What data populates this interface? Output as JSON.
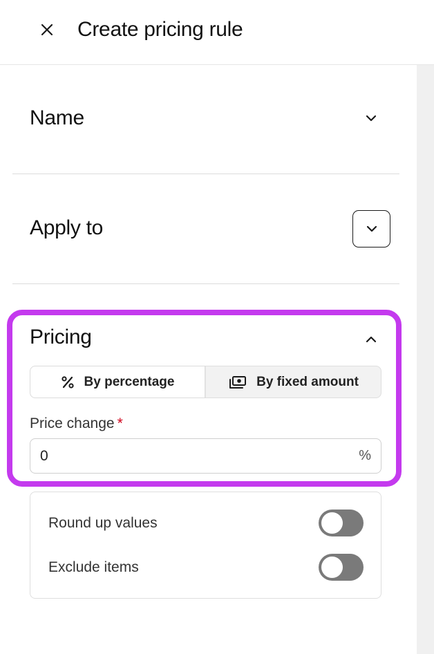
{
  "header": {
    "title": "Create pricing rule",
    "close_icon": "close-icon"
  },
  "sections": {
    "name": {
      "title": "Name",
      "expanded": false
    },
    "apply_to": {
      "title": "Apply to",
      "expanded": false
    },
    "pricing": {
      "title": "Pricing",
      "expanded": true
    }
  },
  "pricing": {
    "modes": [
      {
        "label": "By percentage",
        "icon": "percent-icon",
        "selected": true
      },
      {
        "label": "By fixed amount",
        "icon": "cash-icon",
        "selected": false
      }
    ],
    "price_change": {
      "label": "Price change",
      "required_mark": "*",
      "value": "0",
      "suffix": "%"
    },
    "options": [
      {
        "label": "Round up values",
        "enabled": false
      },
      {
        "label": "Exclude items",
        "enabled": false
      }
    ]
  },
  "colors": {
    "highlight": "#c43aee",
    "required": "#d0021b",
    "toggle_off": "#7a7a7a"
  }
}
